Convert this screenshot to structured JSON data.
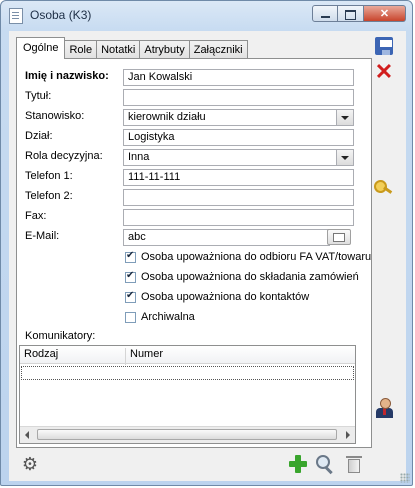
{
  "window": {
    "title": "Osoba  (K3)"
  },
  "tabs": [
    "Ogólne",
    "Role",
    "Notatki",
    "Atrybuty",
    "Załączniki"
  ],
  "form": {
    "name_label": "Imię i nazwisko:",
    "name_value": "Jan Kowalski",
    "title_label": "Tytuł:",
    "title_value": "",
    "position_label": "Stanowisko:",
    "position_value": "kierownik działu",
    "department_label": "Dział:",
    "department_value": "Logistyka",
    "decision_role_label": "Rola decyzyjna:",
    "decision_role_value": "Inna",
    "phone1_label": "Telefon 1:",
    "phone1_value": "111-11-111",
    "phone2_label": "Telefon 2:",
    "phone2_value": "",
    "fax_label": "Fax:",
    "fax_value": "",
    "email_label": "E-Mail:",
    "email_value": "abc"
  },
  "checkboxes": [
    {
      "label": "Osoba upoważniona do odbioru FA VAT/towaru",
      "checked": true
    },
    {
      "label": "Osoba upoważniona do składania zamówień",
      "checked": true
    },
    {
      "label": "Osoba upoważniona do kontaktów",
      "checked": true
    },
    {
      "label": "Archiwalna",
      "checked": false
    }
  ],
  "communicators": {
    "label": "Komunikatory:",
    "columns": [
      "Rodzaj",
      "Numer"
    ]
  },
  "icons": {
    "save": "save-icon",
    "cancel": "cancel-icon",
    "key": "key-icon",
    "person": "person-icon",
    "settings": "gear-icon",
    "add": "plus-icon",
    "search": "search-icon",
    "delete": "trash-icon",
    "email": "envelope-icon"
  },
  "colors": {
    "add": "#39a52d",
    "cancel": "#d11d1d",
    "save": "#3c65b4",
    "window_frame": "#bcd3ee"
  }
}
